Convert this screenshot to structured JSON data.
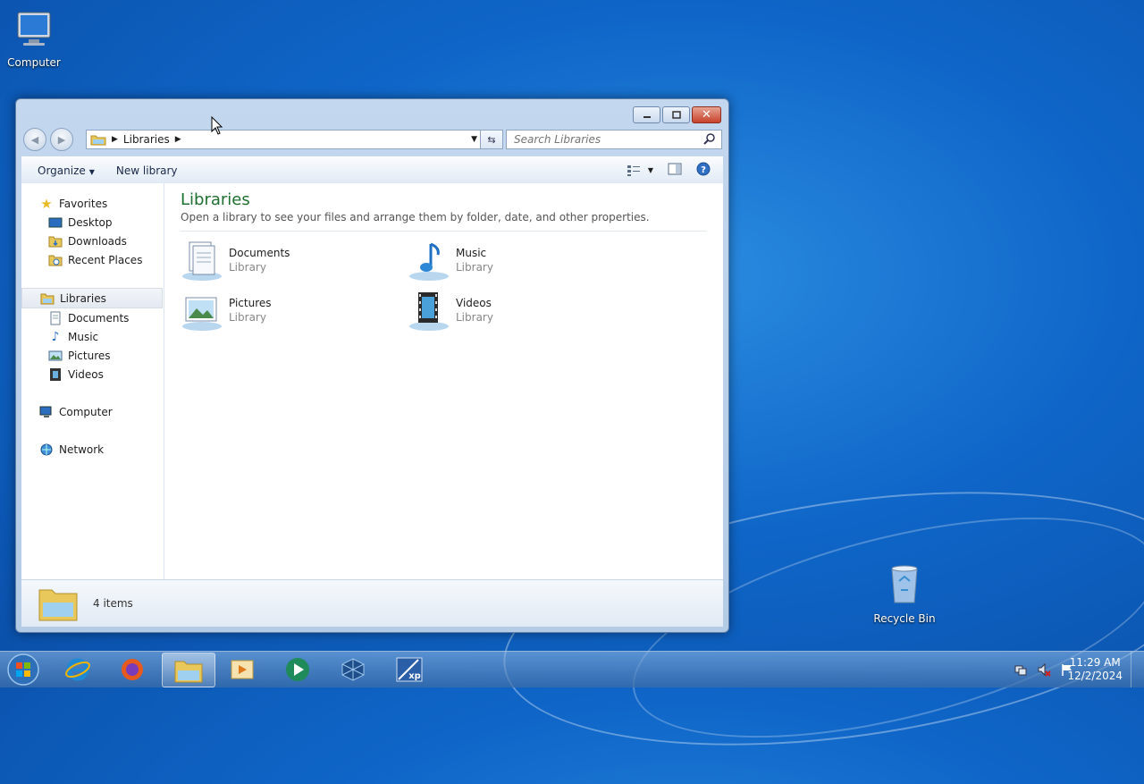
{
  "desktop": {
    "icons": [
      {
        "label": "Computer"
      },
      {
        "label": "Recycle Bin"
      }
    ]
  },
  "window": {
    "address": {
      "segment": "Libraries"
    },
    "search": {
      "placeholder": "Search Libraries"
    },
    "toolbar": {
      "organize": "Organize",
      "new_library": "New library"
    },
    "nav": {
      "favorites": "Favorites",
      "favorites_items": [
        "Desktop",
        "Downloads",
        "Recent Places"
      ],
      "libraries": "Libraries",
      "libraries_items": [
        "Documents",
        "Music",
        "Pictures",
        "Videos"
      ],
      "computer": "Computer",
      "network": "Network"
    },
    "main": {
      "title": "Libraries",
      "description": "Open a library to see your files and arrange them by folder, date, and other properties.",
      "libraries": [
        {
          "name": "Documents",
          "type": "Library",
          "icon": "documents-library-icon"
        },
        {
          "name": "Music",
          "type": "Library",
          "icon": "music-library-icon"
        },
        {
          "name": "Pictures",
          "type": "Library",
          "icon": "pictures-library-icon"
        },
        {
          "name": "Videos",
          "type": "Library",
          "icon": "videos-library-icon"
        }
      ]
    },
    "details": {
      "count": "4 items"
    }
  },
  "taskbar": {
    "apps": [
      "start",
      "internet-explorer",
      "firefox",
      "windows-explorer",
      "media-player",
      "media-center",
      "virtualbox",
      "windows-xp-mode"
    ],
    "clock": {
      "time": "11:29 AM",
      "date": "12/2/2024"
    }
  }
}
